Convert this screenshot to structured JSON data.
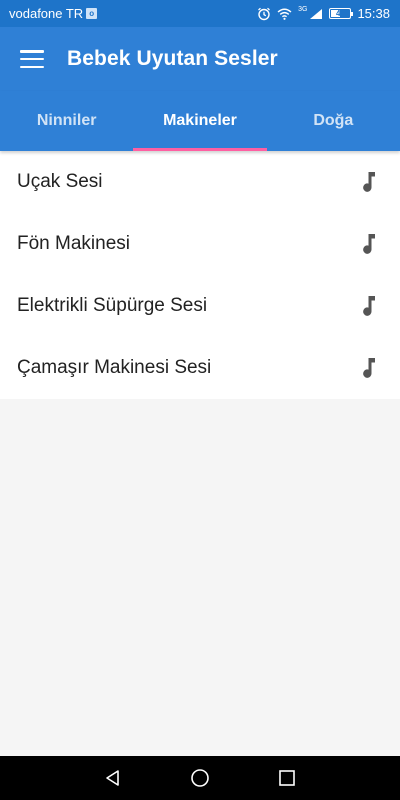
{
  "status_bar": {
    "carrier": "vodafone TR",
    "network": "3G",
    "battery": "41",
    "battery_level": 0.41,
    "time": "15:38",
    "icons": [
      "outlook-icon",
      "alarm-icon",
      "wifi-icon",
      "signal-icon",
      "battery-icon"
    ]
  },
  "app_bar": {
    "title": "Bebek Uyutan Sesler",
    "menu_icon": "hamburger-menu-icon"
  },
  "tabs": [
    {
      "label": "Ninniler",
      "active": false
    },
    {
      "label": "Makineler",
      "active": true
    },
    {
      "label": "Doğa",
      "active": false
    }
  ],
  "list": {
    "items": [
      {
        "label": "Uçak Sesi",
        "icon": "music-note-icon"
      },
      {
        "label": "Fön Makinesi",
        "icon": "music-note-icon"
      },
      {
        "label": "Elektrikli Süpürge Sesi",
        "icon": "music-note-icon"
      },
      {
        "label": "Çamaşır Makinesi Sesi",
        "icon": "music-note-icon"
      }
    ]
  },
  "nav_bar": {
    "icons": [
      "back-icon",
      "home-icon",
      "recents-icon"
    ]
  },
  "colors": {
    "status_bar": "#1e74c9",
    "primary": "#2f80d6",
    "tab_indicator": "#ff5fa2",
    "background": "#f5f5f5",
    "list_background": "#ffffff",
    "icon_gray": "#555555"
  }
}
